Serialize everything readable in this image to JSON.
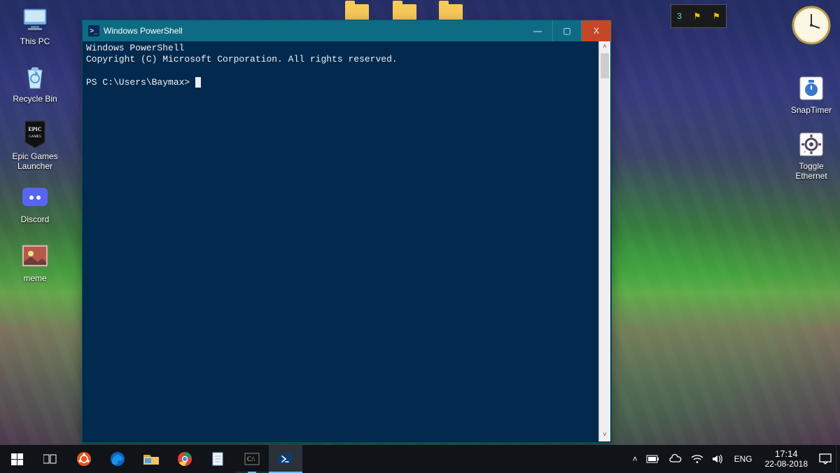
{
  "window": {
    "title": "Windows PowerShell",
    "icon_glyph": ">_",
    "minimize_glyph": "—",
    "maximize_glyph": "▢",
    "close_glyph": "X"
  },
  "terminal": {
    "line1": "Windows PowerShell",
    "line2": "Copyright (C) Microsoft Corporation. All rights reserved.",
    "prompt": "PS C:\\Users\\Baymax>"
  },
  "desktop_icons_left": [
    {
      "id": "this-pc",
      "label": "This PC"
    },
    {
      "id": "recycle-bin",
      "label": "Recycle Bin"
    },
    {
      "id": "epic-games-launcher",
      "label": "Epic Games Launcher"
    },
    {
      "id": "discord",
      "label": "Discord"
    },
    {
      "id": "meme",
      "label": "meme"
    }
  ],
  "desktop_icons_right": [
    {
      "id": "snaptimer",
      "label": "SnapTimer"
    },
    {
      "id": "toggle-ethernet",
      "label": "Toggle Ethernet"
    }
  ],
  "taskbar": {
    "start": "⊞",
    "taskview": "⧉",
    "items": [
      {
        "id": "ubuntu",
        "glyph": "◎",
        "color": "#e95420"
      },
      {
        "id": "edge",
        "glyph": "e",
        "color": "#0b63c4"
      },
      {
        "id": "file-explorer",
        "glyph": "🗂",
        "color": "#f4c655"
      },
      {
        "id": "chrome",
        "glyph": "◉",
        "color": "#f2b90b"
      },
      {
        "id": "notepad",
        "glyph": "📄",
        "color": "#cfe3f7"
      },
      {
        "id": "cmd",
        "glyph": "▮",
        "color": "#d9d9d9"
      },
      {
        "id": "powershell",
        "glyph": ">_",
        "color": "#2e74c6",
        "active": true
      }
    ]
  },
  "tray": {
    "up_glyph": "˄",
    "power_glyph": "🗲",
    "onedrive_glyph": "☁",
    "wifi_glyph": "📶",
    "volume_glyph": "🔊",
    "lang": "ENG",
    "time": "17:14",
    "date": "22-08-2018",
    "action_center_glyph": "💬"
  },
  "colors": {
    "ps_title": "#0e6b84",
    "ps_body": "#022a4f",
    "close": "#c74626"
  }
}
